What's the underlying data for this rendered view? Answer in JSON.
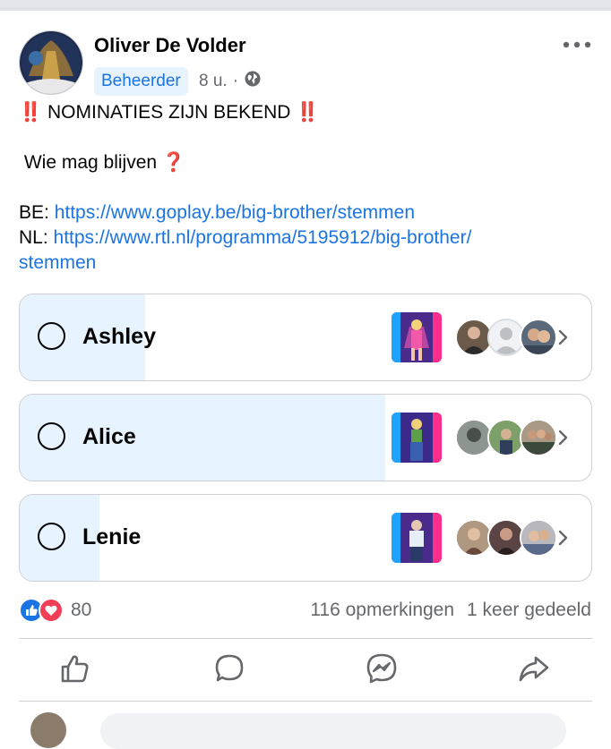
{
  "post": {
    "author": "Oliver De Volder",
    "badge": "Beheerder",
    "time": "8 u.",
    "dot": "·",
    "headline_icon": "‼️",
    "headline": "NOMINATIES ZIJN BEKEND",
    "question": "Wie mag blijven",
    "question_icon": "❓",
    "be_prefix": "BE:",
    "be_link": "https://www.goplay.be/big-brother/stemmen",
    "nl_prefix": "NL:",
    "nl_link_line1": "https://www.rtl.nl/programma/5195912/big-brother/",
    "nl_link_line2": "stemmen"
  },
  "poll": [
    {
      "name": "Ashley",
      "vote_fraction": 0.22,
      "voters": [
        "voter-man-suit",
        "voter-default",
        "voter-couple"
      ]
    },
    {
      "name": "Alice",
      "vote_fraction": 0.64,
      "voters": [
        "voter-grey",
        "voter-outdoor",
        "voter-group"
      ]
    },
    {
      "name": "Lenie",
      "vote_fraction": 0.14,
      "voters": [
        "voter-woman",
        "voter-dark",
        "voter-family"
      ]
    }
  ],
  "footer": {
    "reaction_count": "80",
    "comments": "116 opmerkingen",
    "shares": "1 keer gedeeld"
  },
  "icons": {
    "more": "more-icon",
    "globe": "globe-icon",
    "like": "like-icon",
    "comment": "comment-icon",
    "messenger": "messenger-icon",
    "share": "share-icon"
  },
  "colors": {
    "link": "#1b74e4",
    "poll_fill": "#e7f3ff",
    "badge_bg": "#e7f3ff",
    "alert_red": "#e41e3f",
    "meta_gray": "#65676b"
  }
}
